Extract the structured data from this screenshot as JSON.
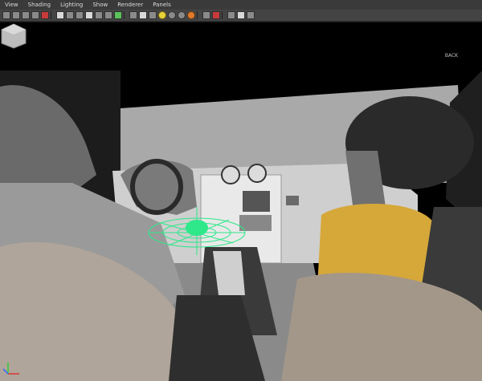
{
  "menubar": {
    "items": [
      "View",
      "Shading",
      "Lighting",
      "Show",
      "Renderer",
      "Panels"
    ]
  },
  "viewcube": {
    "face_label": "BACK"
  },
  "colors": {
    "menubar_bg": "#3a3a3a",
    "toolbar_bg": "#444444",
    "viewport_bg": "#000000",
    "manipulator": "#2ee88a",
    "passenger_shirt": "#d6a83a"
  },
  "icons": [
    "select-camera-icon",
    "lock-camera-icon",
    "camera-attributes-icon",
    "bookmark-icon",
    "image-plane-icon",
    "grid-icon",
    "film-gate-icon",
    "resolution-gate-icon",
    "gate-mask-icon",
    "field-chart-icon",
    "safe-action-icon",
    "safe-title-icon",
    "wireframe-icon",
    "smooth-shade-icon",
    "textured-icon",
    "default-light-icon",
    "all-lights-icon",
    "shadows-icon",
    "isolate-select-icon",
    "xray-icon",
    "xray-joints-icon",
    "xray-components-icon"
  ]
}
